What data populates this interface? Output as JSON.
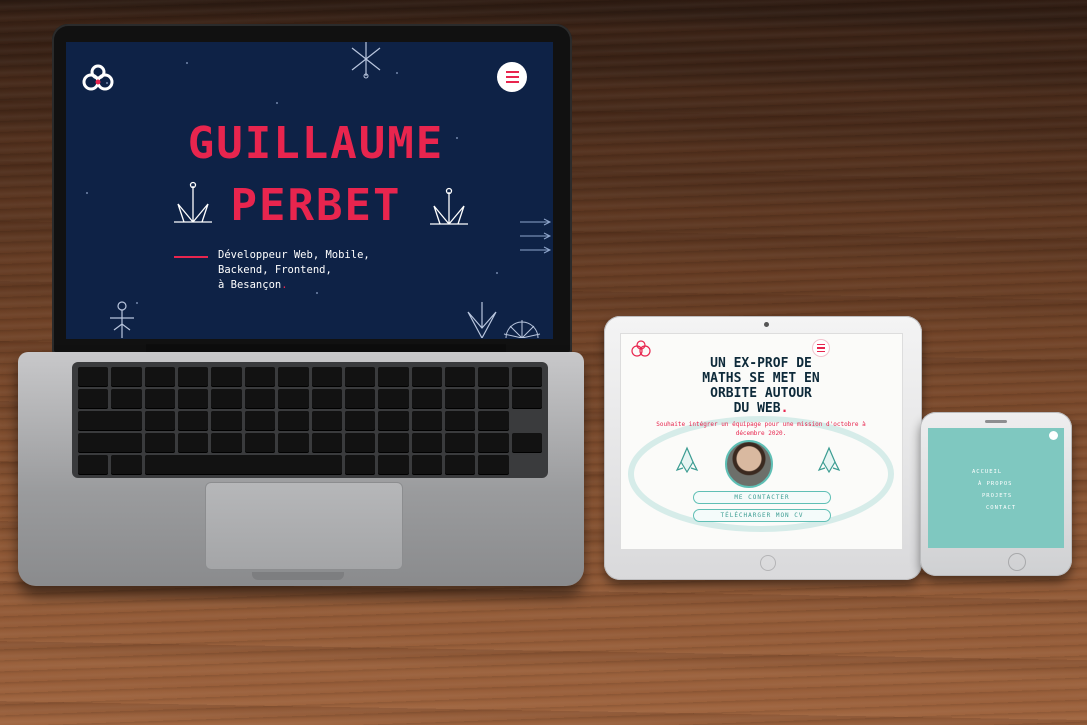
{
  "colors": {
    "laptop_bg": "#0e2246",
    "accent_red": "#e8254e",
    "teal": "#5fbfb5",
    "phone_bg": "#7fc8c0"
  },
  "laptop": {
    "logo_icon": "infinity-logo-icon",
    "menu_icon": "hamburger-menu-icon",
    "title_line1": "GUILLAUME",
    "title_line2": "PERBET",
    "subtitle": "Développeur Web, Mobile,\nBackend, Frontend,\nà Besançon",
    "subtitle_end": "."
  },
  "tablet": {
    "logo_icon": "infinity-logo-icon",
    "menu_icon": "hamburger-menu-icon",
    "headline": "UN EX-PROF DE\nMATHS SE MET EN\nORBITE AUTOUR\nDU WEB",
    "headline_end": ".",
    "text": "Souhaite intégrer un équipage pour une mission d'octobre à décembre 2020.",
    "avatar_icon": "avatar-photo",
    "button_contact": "ME CONTACTER",
    "button_cv": "TÉLÉCHARGER MON CV"
  },
  "phone": {
    "close_icon": "close-dot-icon",
    "nav": [
      {
        "label": "ACCUEIL"
      },
      {
        "label": "À PROPOS"
      },
      {
        "label": "PROJETS"
      },
      {
        "label": "CONTACT"
      }
    ]
  }
}
